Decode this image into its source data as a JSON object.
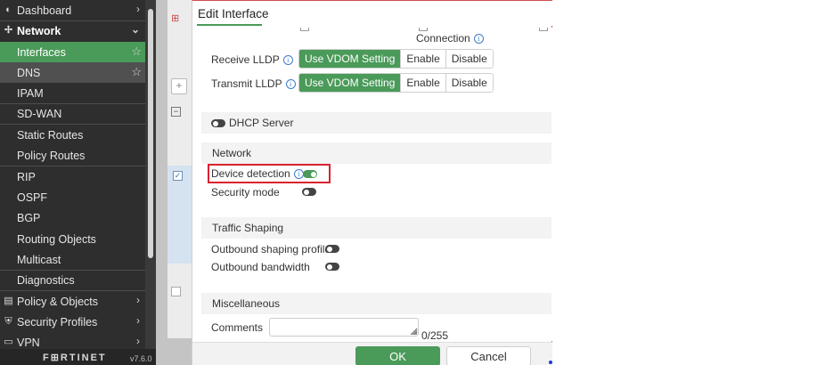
{
  "sidebar": {
    "items": [
      {
        "label": "Dashboard",
        "icon": "dashboard-icon"
      },
      {
        "label": "Network",
        "icon": "network-icon"
      },
      {
        "label": "Interfaces"
      },
      {
        "label": "DNS"
      },
      {
        "label": "IPAM"
      },
      {
        "label": "SD-WAN"
      },
      {
        "label": "Static Routes"
      },
      {
        "label": "Policy Routes"
      },
      {
        "label": "RIP"
      },
      {
        "label": "OSPF"
      },
      {
        "label": "BGP"
      },
      {
        "label": "Routing Objects"
      },
      {
        "label": "Multicast"
      },
      {
        "label": "Diagnostics"
      },
      {
        "label": "Policy & Objects",
        "icon": "policy-icon"
      },
      {
        "label": "Security Profiles",
        "icon": "security-icon"
      },
      {
        "label": "VPN",
        "icon": "vpn-icon"
      }
    ],
    "logo": "F⊞RTINET",
    "version": "v7.6.0"
  },
  "dialog": {
    "title": "Edit Interface",
    "partial_top_label": "Connection",
    "receive_lldp": {
      "label": "Receive LLDP",
      "options": [
        "Use VDOM Setting",
        "Enable",
        "Disable"
      ],
      "selected": "Use VDOM Setting"
    },
    "transmit_lldp": {
      "label": "Transmit LLDP",
      "options": [
        "Use VDOM Setting",
        "Enable",
        "Disable"
      ],
      "selected": "Use VDOM Setting"
    },
    "dhcp_server": {
      "label": "DHCP Server",
      "enabled": false
    },
    "network_section": "Network",
    "device_detection": {
      "label": "Device detection",
      "enabled": true
    },
    "security_mode": {
      "label": "Security mode",
      "enabled": false
    },
    "traffic_section": "Traffic Shaping",
    "outbound_profile": {
      "label": "Outbound shaping profile",
      "enabled": false
    },
    "outbound_bandwidth": {
      "label": "Outbound bandwidth",
      "enabled": false
    },
    "misc_section": "Miscellaneous",
    "comments": {
      "label": "Comments",
      "value": "",
      "counter": "0/255"
    },
    "ok_label": "OK",
    "cancel_label": "Cancel"
  },
  "colors": {
    "accent": "#4a9a59",
    "sidebar_bg": "#2e2e2e",
    "highlight": "#d9232e",
    "info": "#3d7cc9"
  }
}
